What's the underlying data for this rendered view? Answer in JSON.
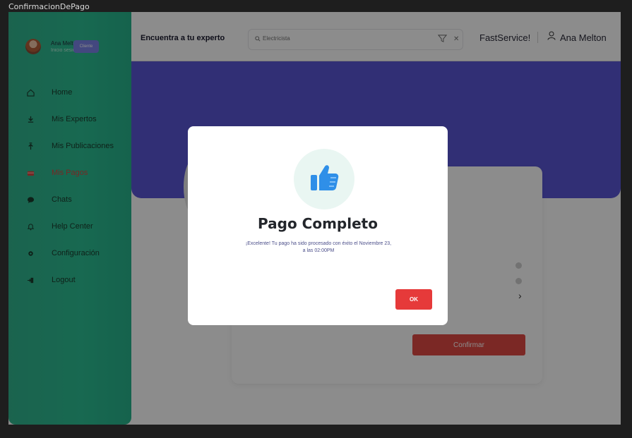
{
  "window": {
    "title": "ConfirmacionDePago"
  },
  "sidebar": {
    "profile": {
      "name": "Ana Melton",
      "subtitle": "Inicio sesión",
      "role_badge": "Cliente"
    },
    "items": [
      {
        "label": "Home",
        "icon": "home-icon"
      },
      {
        "label": "Mis Expertos",
        "icon": "experts-icon"
      },
      {
        "label": "Mis Publicaciones",
        "icon": "publications-icon"
      },
      {
        "label": "Mis Pagos",
        "icon": "payments-icon",
        "active": true
      },
      {
        "label": "Chats",
        "icon": "chat-icon"
      },
      {
        "label": "Help Center",
        "icon": "bell-icon"
      },
      {
        "label": "Configuración",
        "icon": "gear-icon"
      },
      {
        "label": "Logout",
        "icon": "logout-icon"
      }
    ]
  },
  "topbar": {
    "title": "Encuentra a tu experto",
    "search": {
      "placeholder": "Electricista"
    },
    "brand": "FastService!",
    "user_name": "Ana Melton"
  },
  "main": {
    "confirm_label": "Confirmar"
  },
  "modal": {
    "title": "Pago Completo",
    "message": "¡Excelente! Tu pago ha sido procesado con éxito el Noviembre 23, a las 02:00PM",
    "ok_label": "OK"
  },
  "colors": {
    "sidebar_green": "#2cbf94",
    "banner_purple": "#5a57d6",
    "accent_red": "#e63a3a",
    "thumb_blue": "#2f8fe8"
  }
}
